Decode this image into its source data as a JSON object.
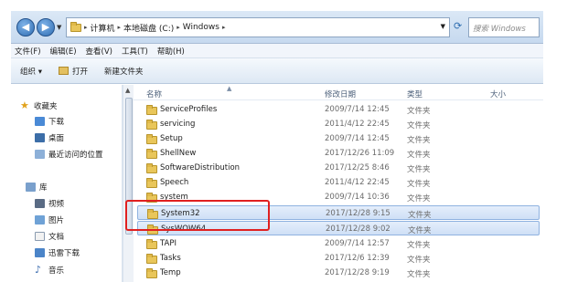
{
  "address_bar": {
    "crumbs": [
      "计算机",
      "本地磁盘 (C:)",
      "Windows"
    ],
    "search_placeholder": "搜索 Windows"
  },
  "menu": [
    "文件(F)",
    "编辑(E)",
    "查看(V)",
    "工具(T)",
    "帮助(H)"
  ],
  "toolbar": {
    "organize": "组织 ▾",
    "open": "打开",
    "new_folder": "新建文件夹"
  },
  "nav": {
    "favorites": "收藏夹",
    "downloads": "下载",
    "desktop": "桌面",
    "recent": "最近访问的位置",
    "libraries": "库",
    "videos": "视频",
    "pictures": "图片",
    "documents": "文档",
    "xunlei": "迅雷下载",
    "music": "音乐"
  },
  "columns": {
    "name": "名称",
    "date": "修改日期",
    "type": "类型",
    "size": "大小"
  },
  "files": [
    {
      "name": "ServiceProfiles",
      "date": "2009/7/14 12:45",
      "type": "文件夹"
    },
    {
      "name": "servicing",
      "date": "2011/4/12 22:45",
      "type": "文件夹"
    },
    {
      "name": "Setup",
      "date": "2009/7/14 12:45",
      "type": "文件夹"
    },
    {
      "name": "ShellNew",
      "date": "2017/12/26 11:09",
      "type": "文件夹"
    },
    {
      "name": "SoftwareDistribution",
      "date": "2017/12/25 8:46",
      "type": "文件夹"
    },
    {
      "name": "Speech",
      "date": "2011/4/12 22:45",
      "type": "文件夹"
    },
    {
      "name": "system",
      "date": "2009/7/14 10:36",
      "type": "文件夹"
    },
    {
      "name": "System32",
      "date": "2017/12/28 9:15",
      "type": "文件夹"
    },
    {
      "name": "SysWOW64",
      "date": "2017/12/28 9:02",
      "type": "文件夹"
    },
    {
      "name": "TAPI",
      "date": "2009/7/14 12:57",
      "type": "文件夹"
    },
    {
      "name": "Tasks",
      "date": "2017/12/6 12:39",
      "type": "文件夹"
    },
    {
      "name": "Temp",
      "date": "2017/12/28 9:19",
      "type": "文件夹"
    }
  ],
  "colors": {
    "highlight": "#e02020",
    "selection": "#cfe0f6"
  }
}
